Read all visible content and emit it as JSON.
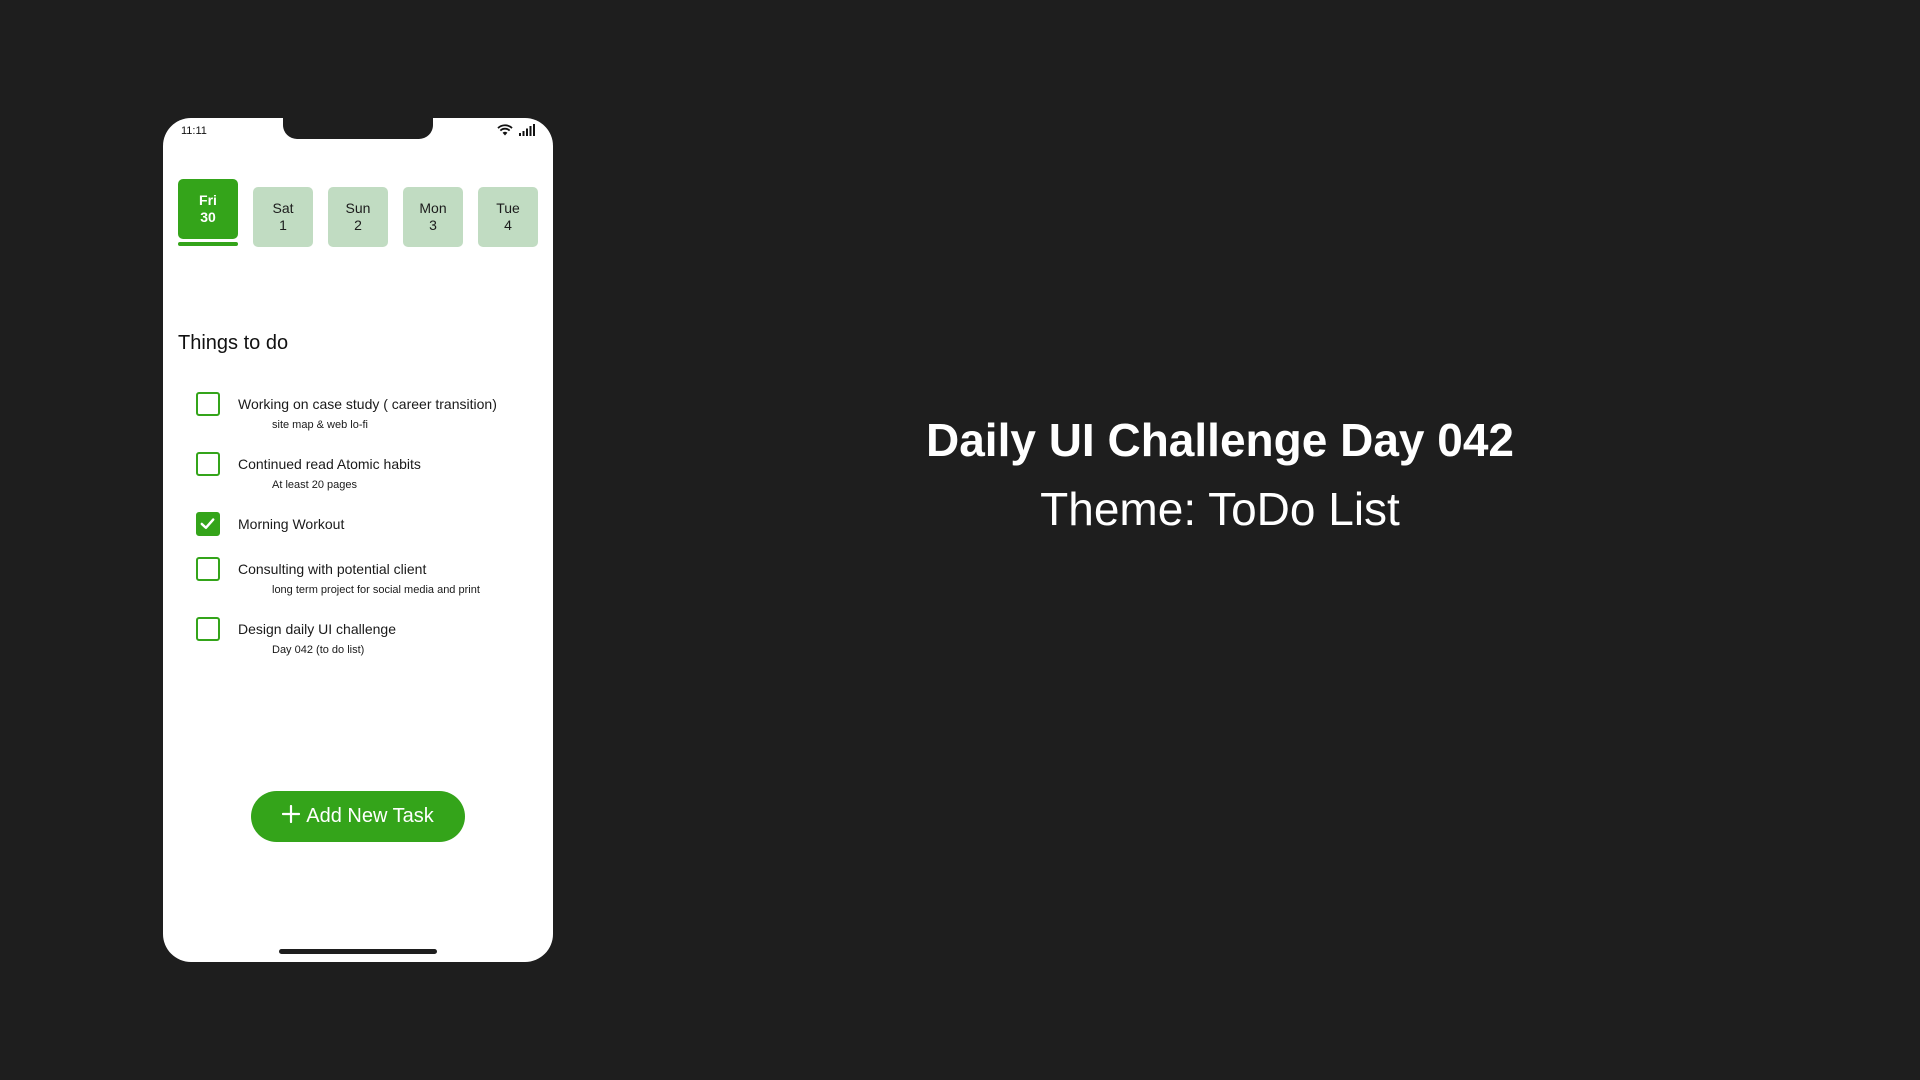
{
  "status_bar": {
    "time": "11:11",
    "icons": [
      "wifi-icon",
      "signal-icon"
    ]
  },
  "days": [
    {
      "weekday": "Fri",
      "date": "30",
      "selected": true
    },
    {
      "weekday": "Sat",
      "date": "1",
      "selected": false
    },
    {
      "weekday": "Sun",
      "date": "2",
      "selected": false
    },
    {
      "weekday": "Mon",
      "date": "3",
      "selected": false
    },
    {
      "weekday": "Tue",
      "date": "4",
      "selected": false
    }
  ],
  "section_title": "Things to do",
  "tasks": [
    {
      "title": "Working on case study ( career transition)",
      "subtitle": "site map & web lo-fi",
      "done": false
    },
    {
      "title": "Continued read Atomic habits",
      "subtitle": "At least 20 pages",
      "done": false
    },
    {
      "title": "Morning Workout",
      "subtitle": "",
      "done": true
    },
    {
      "title": "Consulting with potential client",
      "subtitle": "long term project for social media and print",
      "done": false
    },
    {
      "title": "Design daily UI challenge",
      "subtitle": "Day 042 (to do list)",
      "done": false
    }
  ],
  "add_button": {
    "icon": "plus-icon",
    "label": "Add New Task"
  },
  "headline": {
    "title": "Daily UI Challenge Day 042",
    "subtitle": "Theme: ToDo List"
  },
  "colors": {
    "accent": "#34a41a",
    "day_inactive": "#c1dcc2",
    "background": "#1e1e1e",
    "phone": "#ffffff"
  }
}
